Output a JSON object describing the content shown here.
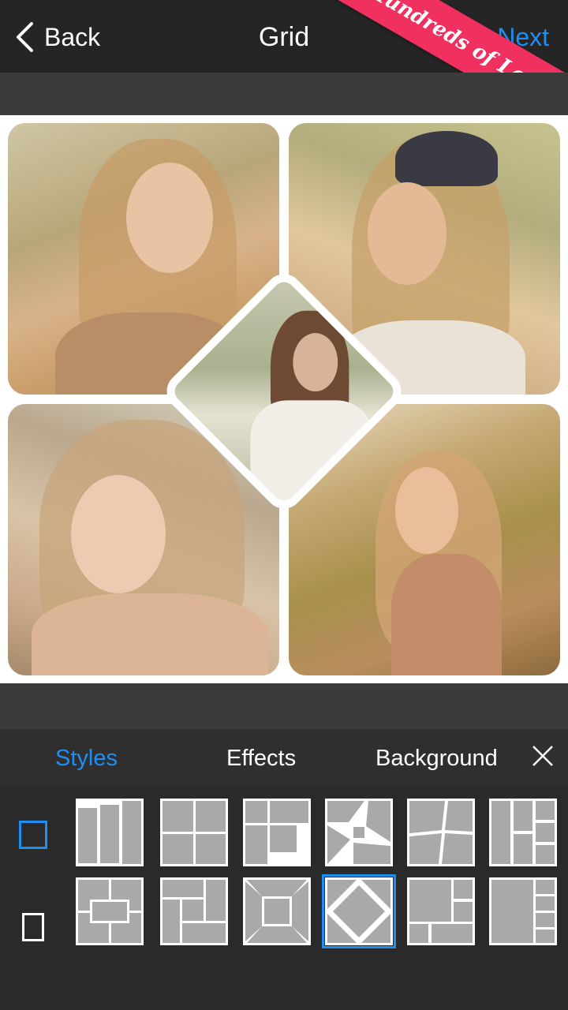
{
  "header": {
    "back_label": "Back",
    "title": "Grid",
    "next_label": "Next",
    "ribbon_text": "Hundreds of Layouts"
  },
  "tabs": [
    {
      "label": "Styles",
      "active": true
    },
    {
      "label": "Effects",
      "active": false
    },
    {
      "label": "Background",
      "active": false
    }
  ],
  "aspect_ratios": [
    {
      "name": "square",
      "selected": true
    },
    {
      "name": "portrait",
      "selected": false
    }
  ],
  "layouts_selected_index": 9,
  "colors": {
    "accent": "#1e8ff2",
    "ribbon": "#f0305f",
    "topbar": "#252525",
    "panel": "#2a2a2a"
  }
}
